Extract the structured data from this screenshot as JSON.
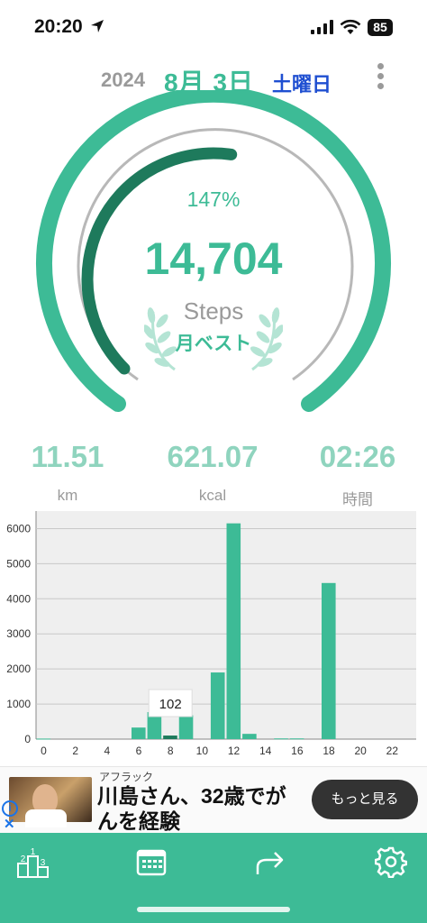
{
  "status_bar": {
    "time": "20:20",
    "battery": "85"
  },
  "header": {
    "year": "2024",
    "month_day": "8月 3日",
    "weekday": "土曜日"
  },
  "gauge": {
    "percent_label": "147%",
    "progress_fraction": 1.47,
    "steps": "14,704",
    "unit": "Steps",
    "badge": "月ベスト"
  },
  "stats": [
    {
      "value": "11.51",
      "unit": "km"
    },
    {
      "value": "621.07",
      "unit": "kcal"
    },
    {
      "value": "02:26",
      "unit": "時間"
    }
  ],
  "chart_data": {
    "type": "bar",
    "x": [
      0,
      1,
      2,
      3,
      4,
      5,
      6,
      7,
      8,
      9,
      10,
      11,
      12,
      13,
      14,
      15,
      16,
      17,
      18,
      19,
      20,
      21,
      22,
      23
    ],
    "values": [
      15,
      0,
      0,
      0,
      0,
      0,
      330,
      770,
      102,
      680,
      0,
      1900,
      6150,
      150,
      0,
      20,
      20,
      0,
      4450,
      0,
      0,
      0,
      0,
      0
    ],
    "highlight_index": 8,
    "tooltip": "102",
    "x_ticks": [
      "0",
      "2",
      "4",
      "6",
      "8",
      "10",
      "12",
      "14",
      "16",
      "18",
      "20",
      "22"
    ],
    "y_ticks": [
      "0",
      "1000",
      "2000",
      "3000",
      "4000",
      "5000",
      "6000"
    ],
    "ylim": [
      0,
      6500
    ],
    "bar_color": "#3dbb96",
    "highlight_color": "#1e7a5c",
    "grid": true
  },
  "ad": {
    "sponsor": "アフラック",
    "headline": "川島さん、32歳でがんを経験",
    "cta": "もっと見る",
    "info": "i",
    "close": "✕"
  },
  "toolbar": [
    {
      "icon": "ranking-icon"
    },
    {
      "icon": "calendar-icon"
    },
    {
      "icon": "share-icon"
    },
    {
      "icon": "settings-icon"
    }
  ],
  "colors": {
    "accent": "#3dbb96",
    "accent_dark": "#1e7a5c",
    "weekday_blue": "#1f4fd1"
  }
}
